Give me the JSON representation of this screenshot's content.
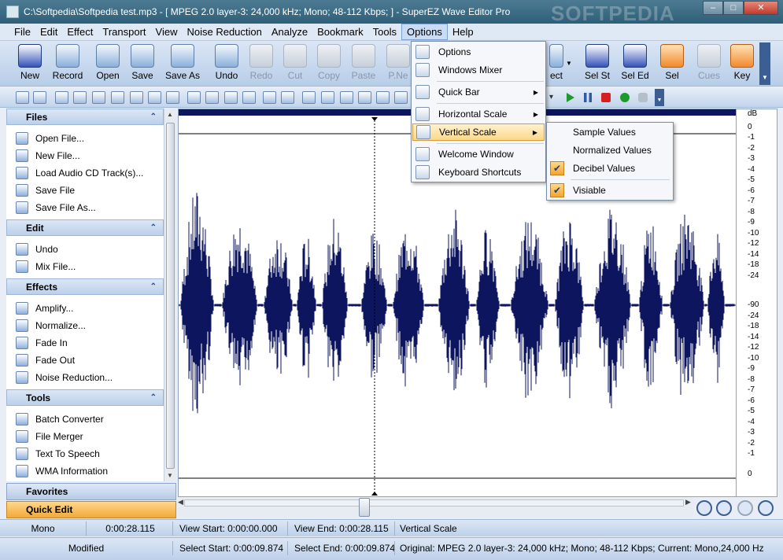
{
  "window": {
    "title": "C:\\Softpedia\\Softpedia test.mp3 - [ MPEG 2.0 layer-3: 24,000 kHz; Mono; 48-112 Kbps;  ] - SuperEZ Wave Editor Pro",
    "watermark": "SOFTPEDIA",
    "btn_min": "–",
    "btn_max": "□",
    "btn_close": "✕"
  },
  "menubar": [
    "File",
    "Edit",
    "Effect",
    "Transport",
    "View",
    "Noise Reduction",
    "Analyze",
    "Bookmark",
    "Tools",
    "Options",
    "Help"
  ],
  "toolbar": {
    "new": "New",
    "record": "Record",
    "open": "Open",
    "save": "Save",
    "save_as": "Save As",
    "undo": "Undo",
    "redo": "Redo",
    "cut": "Cut",
    "copy": "Copy",
    "paste": "Paste",
    "paste_new": "P.Ne",
    "effect": "ect",
    "sel_st": "Sel St",
    "sel_ed": "Sel Ed",
    "sel": "Sel",
    "cues": "Cues",
    "key": "Key"
  },
  "panel": {
    "files": {
      "header": "Files",
      "items": [
        "Open File...",
        "New File...",
        "Load Audio CD Track(s)...",
        "Save File",
        "Save File As..."
      ]
    },
    "edit": {
      "header": "Edit",
      "items": [
        "Undo",
        "Mix File..."
      ]
    },
    "effects": {
      "header": "Effects",
      "items": [
        "Amplify...",
        "Normalize...",
        "Fade In",
        "Fade Out",
        "Noise Reduction..."
      ]
    },
    "tools": {
      "header": "Tools",
      "items": [
        "Batch Converter",
        "File Merger",
        "Text To Speech",
        "WMA Information"
      ]
    },
    "favorites": "Favorites",
    "quick_edit": "Quick Edit"
  },
  "db_scale": {
    "unit": "dB",
    "ticks": [
      "0",
      "-1",
      "-2",
      "-3",
      "-4",
      "-5",
      "-6",
      "-7",
      "-8",
      "-9",
      "-10",
      "-12",
      "-14",
      "-18",
      "-24",
      "-90",
      "-24",
      "-18",
      "-14",
      "-12",
      "-10",
      "-9",
      "-8",
      "-7",
      "-6",
      "-5",
      "-4",
      "-3",
      "-2",
      "-1",
      "0"
    ]
  },
  "options_menu": {
    "options": "Options",
    "windows_mixer": "Windows Mixer",
    "quick_bar": "Quick Bar",
    "horizontal_scale": "Horizontal Scale",
    "vertical_scale": "Vertical Scale",
    "welcome_window": "Welcome Window",
    "keyboard_shortcuts": "Keyboard Shortcuts"
  },
  "vertical_scale_submenu": {
    "sample_values": "Sample Values",
    "normalized_values": "Normalized Values",
    "decibel_values": "Decibel Values",
    "visiable": "Visiable",
    "checked": [
      "Decibel Values",
      "Visiable"
    ]
  },
  "status1": {
    "channel": "Mono",
    "length": "0:00:28.115",
    "view_start": "View Start: 0:00:00.000",
    "view_end": "View End: 0:00:28.115",
    "hint": "Vertical Scale"
  },
  "status2": {
    "state": "Modified",
    "select_start": "Select Start: 0:00:09.874",
    "select_end": "Select End: 0:00:09.874",
    "original": "Original: MPEG 2.0 layer-3: 24,000 kHz; Mono; 48-112 Kbps;  Current: Mono,24,000 Hz"
  },
  "colors": {
    "waveform": "#0d155e",
    "menu_highlight": "#fbd78a",
    "quick_edit": "#f2a93b"
  }
}
